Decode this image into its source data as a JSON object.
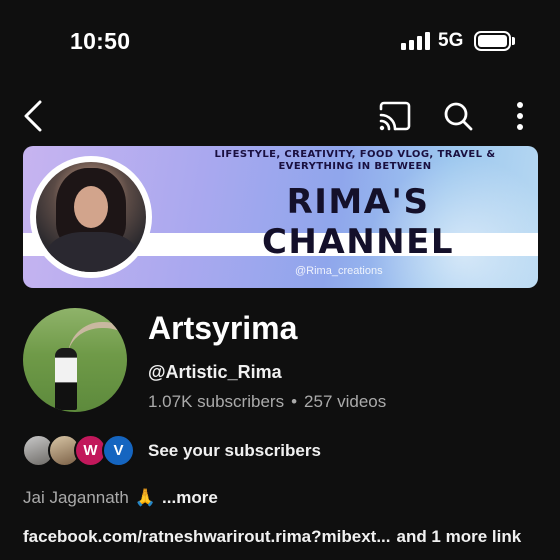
{
  "status_bar": {
    "time": "10:50",
    "network": "5G",
    "battery_level": 1.0,
    "signal_bars": 4
  },
  "app_bar": {
    "icons": [
      "back-arrow-icon",
      "cast-icon",
      "search-icon",
      "more-vert-icon"
    ]
  },
  "banner": {
    "tagline": "LIFESTYLE, CREATIVITY, FOOD VLOG, TRAVEL & EVERYTHING IN BETWEEN",
    "title": "RIMA'S CHANNEL",
    "handle": "@Rima_creations"
  },
  "channel": {
    "name": "Artsyrima",
    "handle": "@Artistic_Rima",
    "subscribers": "1.07K subscribers",
    "separator": "•",
    "videos": "257 videos"
  },
  "subscribers_row": {
    "avatars": [
      {
        "letter": ""
      },
      {
        "letter": ""
      },
      {
        "letter": "W",
        "color": "#c2185b"
      },
      {
        "letter": "V",
        "color": "#1565c0"
      }
    ],
    "label": "See your subscribers"
  },
  "description": {
    "text": "Jai Jagannath",
    "emoji": "🙏",
    "more_label": "...more"
  },
  "links": {
    "primary": "facebook.com/ratneshwarirout.rima?mibext...",
    "more": "and 1 more link"
  },
  "colors": {
    "background": "#0f0f0f",
    "text_primary": "#f1f1f1",
    "text_secondary": "#aaaaaa"
  }
}
